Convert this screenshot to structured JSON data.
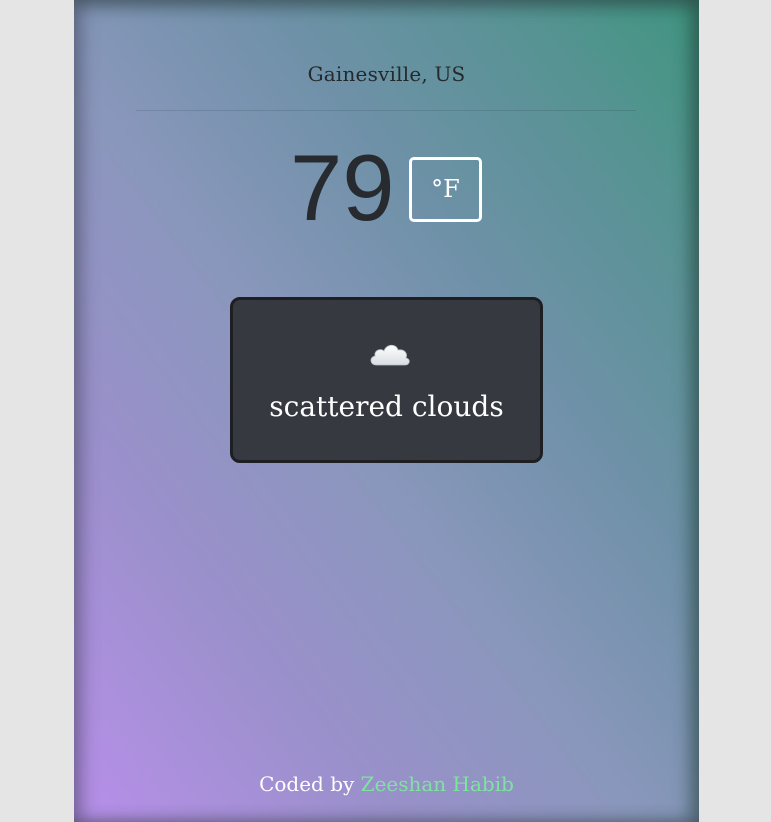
{
  "location": "Gainesville, US",
  "temperature": {
    "value": "79",
    "unit_label": "°F"
  },
  "condition": {
    "icon": "cloud-icon",
    "description": "scattered clouds"
  },
  "footer": {
    "prefix": "Coded by ",
    "author": "Zeeshan Habib"
  },
  "colors": {
    "page_background": "#e6e5e5",
    "gradient_start": "#b88fea",
    "gradient_end": "#3f957f",
    "condition_box": "#363a40",
    "author_link": "#7fe3a0"
  }
}
